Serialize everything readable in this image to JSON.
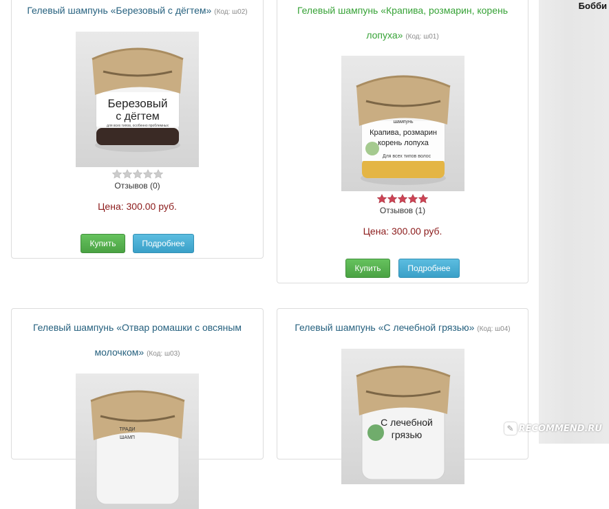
{
  "user": {
    "name": "Бобби"
  },
  "watermark": {
    "text": "RECOMMEND.RU",
    "icon": "recommend-logo-icon"
  },
  "colors": {
    "title_link": "#25607e",
    "title_link_active": "#36a236",
    "price": "#8b1a1a",
    "buy_button": "#4aa243",
    "more_button": "#3aa0c8",
    "star_filled": "#cc4455",
    "star_empty": "#cccccc"
  },
  "products": [
    {
      "title_line1": "Гелевый шампунь «Березовый с дёгтем»",
      "title_line2": "",
      "code": "(Код: ш02)",
      "image_label_1": "Березовый",
      "image_label_2": "с дёгтем",
      "image_small": "для всех типов, особенно проблемных",
      "rating": 0,
      "reviews": "Отзывов (0)",
      "price": "Цена: 300.00 руб.",
      "buy_label": "Купить",
      "more_label": "Подробнее"
    },
    {
      "title_line1": "Гелевый шампунь «Крапива, розмарин, корень",
      "title_line2": "лопуха»",
      "code": "(Код: ш01)",
      "image_label_0": "шампунь",
      "image_label_1": "Крапива, розмарин",
      "image_label_2": "корень лопуха",
      "image_small": "Для всех типов волос",
      "rating": 5,
      "reviews": "Отзывов (1)",
      "price": "Цена: 300.00 руб.",
      "buy_label": "Купить",
      "more_label": "Подробнее"
    },
    {
      "title_line1": "Гелевый шампунь «Отвар ромашки с овсяным",
      "title_line2": "молочком»",
      "code": "(Код: ш03)",
      "image_label_1": "ТРАДИ",
      "image_label_2": "ШАМП"
    },
    {
      "title_line1": "Гелевый шампунь «С лечебной грязью»",
      "title_line2": "",
      "code": "(Код: ш04)",
      "image_label_1": "С лечебной",
      "image_label_2": "грязью"
    }
  ]
}
